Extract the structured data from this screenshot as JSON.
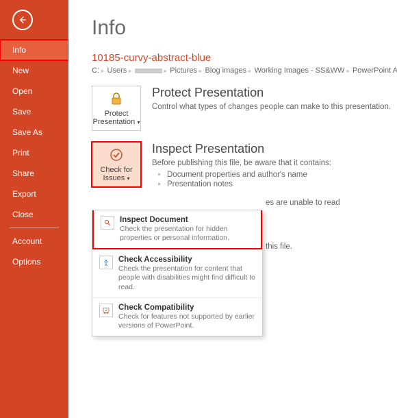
{
  "sidebar": {
    "items": [
      {
        "label": "Info",
        "active": true
      },
      {
        "label": "New"
      },
      {
        "label": "Open"
      },
      {
        "label": "Save"
      },
      {
        "label": "Save As"
      },
      {
        "label": "Print"
      },
      {
        "label": "Share"
      },
      {
        "label": "Export"
      },
      {
        "label": "Close"
      }
    ],
    "footer": [
      {
        "label": "Account"
      },
      {
        "label": "Options"
      }
    ]
  },
  "page": {
    "heading": "Info",
    "doc_title": "10185-curvy-abstract-blue",
    "breadcrumb": [
      "C:",
      "Users",
      "[redacted]",
      "Pictures",
      "Blog images",
      "Working Images - SS&WW",
      "PowerPoint Article - Working"
    ]
  },
  "protect": {
    "tile_label": "Protect Presentation",
    "heading": "Protect Presentation",
    "desc": "Control what types of changes people can make to this presentation."
  },
  "inspect": {
    "tile_label": "Check for Issues",
    "heading": "Inspect Presentation",
    "intro": "Before publishing this file, be aware that it contains:",
    "bullets": [
      "Document properties and author's name",
      "Presentation notes"
    ],
    "overflow_line1": "es are unable to read",
    "overflow_line2": "this file."
  },
  "dropdown": [
    {
      "title": "Inspect Document",
      "desc": "Check the presentation for hidden properties or personal information.",
      "icon": "magnifier",
      "highlight": true
    },
    {
      "title": "Check Accessibility",
      "desc": "Check the presentation for content that people with disabilities might find difficult to read.",
      "icon": "accessibility"
    },
    {
      "title": "Check Compatibility",
      "desc": "Check for features not supported by earlier versions of PowerPoint.",
      "icon": "compat"
    }
  ]
}
